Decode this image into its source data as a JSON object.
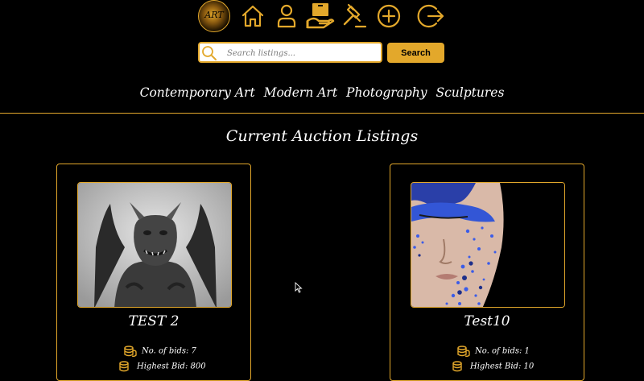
{
  "nav": {
    "logo_text": "ART",
    "icons": [
      "home-icon",
      "profile-icon",
      "my-listings-icon",
      "auction-gavel-icon",
      "add-listing-icon",
      "logout-icon"
    ]
  },
  "search": {
    "placeholder": "Search listings...",
    "button_label": "Search"
  },
  "categories": [
    "Contemporary Art",
    "Modern Art",
    "Photography",
    "Sculptures"
  ],
  "page_heading": "Current Auction Listings",
  "colors": {
    "accent": "#e3a82b",
    "background": "#000000",
    "text": "#ffffff"
  },
  "listings": [
    {
      "title": "TEST 2",
      "bids_text": "No. of bids: 7",
      "highest_bid_text": "Highest Bid: 800",
      "image_subject": "gargoyle statue"
    },
    {
      "title": "Test10",
      "bids_text": "No. of bids: 1",
      "highest_bid_text": "Highest Bid: 10",
      "image_subject": "blue glitter face"
    }
  ]
}
